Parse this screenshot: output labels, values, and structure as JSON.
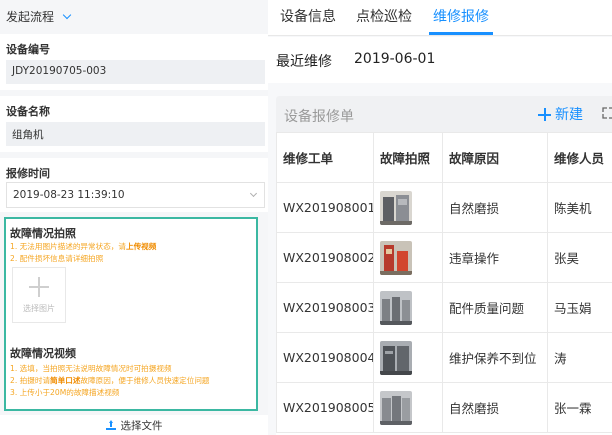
{
  "flow": {
    "label": "发起流程"
  },
  "fields": {
    "device_no": {
      "label": "设备编号",
      "value": "JDY20190705-003"
    },
    "device_name": {
      "label": "设备名称",
      "value": "组角机"
    },
    "report_time": {
      "label": "报修时间",
      "value": "2019-08-23 11:39:10"
    }
  },
  "fault_photo": {
    "title": "故障情况拍照",
    "hint1_pre": "1. 无法用图片描述的异常状态，请",
    "hint1_bold": "上传视频",
    "hint2": "2. 配件损坏信息请详细拍照",
    "upload_label": "选择图片"
  },
  "fault_video": {
    "title": "故障情况视频",
    "hint1": "1. 选填，当拍照无法说明故障情况时可拍摄视频",
    "hint2_pre": "2. 拍摄时请",
    "hint2_bold": "简单口述",
    "hint2_post": "故障原因，便于维修人员快速定位问题",
    "hint3": "3. 上传小于20M的故障描述视频",
    "file_button": "选择文件"
  },
  "tabs": [
    {
      "label": "设备信息",
      "active": false
    },
    {
      "label": "点检巡检",
      "active": false
    },
    {
      "label": "维修报修",
      "active": true
    }
  ],
  "recent": {
    "label": "最近维修",
    "date": "2019-06-01"
  },
  "repair_list": {
    "title": "设备报修单",
    "new_label": "新建",
    "columns": [
      "维修工单",
      "故障拍照",
      "故障原因",
      "维修人员"
    ],
    "rows": [
      {
        "order": "WX201908001",
        "reason": "自然磨损",
        "person": "陈美机"
      },
      {
        "order": "WX201908002",
        "reason": "违章操作",
        "person": "张昊"
      },
      {
        "order": "WX201908003",
        "reason": "配件质量问题",
        "person": "马玉娟"
      },
      {
        "order": "WX201908004",
        "reason": "维护保养不到位",
        "person": "涛"
      },
      {
        "order": "WX201908005",
        "reason": "自然磨损",
        "person": "张一霖"
      }
    ]
  },
  "colors": {
    "accent": "#1890ff",
    "highlight_border": "#3bb8a2",
    "hint": "#f5a623"
  }
}
